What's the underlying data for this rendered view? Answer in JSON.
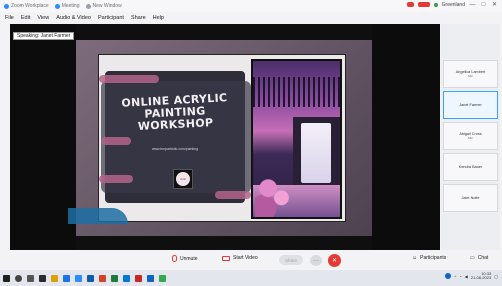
{
  "titlebar": {
    "tabs": [
      "Zoom Workplace",
      "Meeting",
      "New Window"
    ],
    "account": "Greenland",
    "window_controls": [
      "—",
      "□",
      "✕"
    ]
  },
  "menu": [
    "File",
    "Edit",
    "View",
    "Audio & Video",
    "Participant",
    "Share",
    "Help"
  ],
  "speaking_label": "Speaking: Janet Farmer",
  "slide": {
    "title": "ONLINE ACRYLIC PAINTING WORKSHOP",
    "subtitle": "www.bmpartistic.com/painting",
    "logo_text": "ArtZ"
  },
  "participants": [
    {
      "name": "Angelica Lambert",
      "status": "Mic"
    },
    {
      "name": "Janet Farmer",
      "status": "",
      "selected": true
    },
    {
      "name": "Abigail Cross",
      "status": "Mic"
    },
    {
      "name": "Kendra Bauer",
      "status": ""
    },
    {
      "name": "Jake Nolte",
      "status": ""
    }
  ],
  "controls": {
    "unmute": "Unmute",
    "start_video": "Start Video",
    "share": "Share",
    "more": "···",
    "participants": "Participants",
    "chat": "Chat"
  },
  "taskbar": {
    "time": "10:33",
    "date": "21-08-2023"
  },
  "colors": {
    "accent": "#2d8cff",
    "end": "#e53935",
    "selected_border": "#3aa0ff"
  }
}
